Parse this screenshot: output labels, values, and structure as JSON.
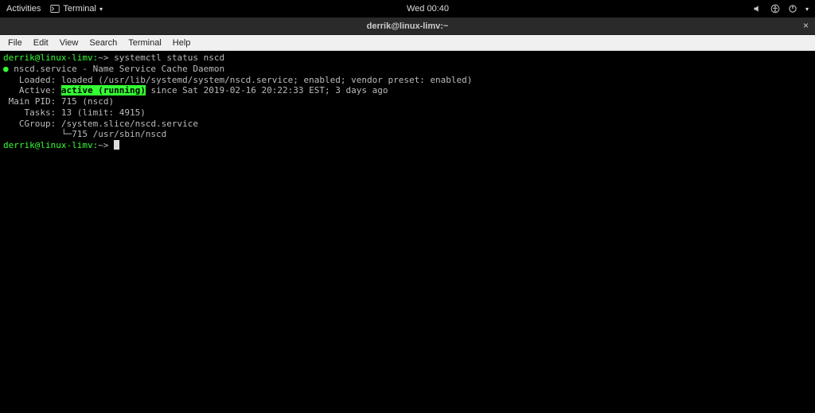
{
  "topbar": {
    "activities": "Activities",
    "app_label": "Terminal",
    "clock": "Wed 00:40"
  },
  "titlebar": {
    "title": "derrik@linux-limv:~",
    "close": "×"
  },
  "menubar": {
    "items": [
      "File",
      "Edit",
      "View",
      "Search",
      "Terminal",
      "Help"
    ]
  },
  "terminal": {
    "prompt1_user": "derrik@linux-limv:",
    "prompt1_path": "~>",
    "prompt1_cmd": " systemctl status nscd",
    "line_service": "nscd.service - Name Service Cache Daemon",
    "loaded_label": "   Loaded: ",
    "loaded_value": "loaded (/usr/lib/systemd/system/nscd.service; enabled; vendor preset: enabled)",
    "active_label": "   Active: ",
    "active_value": "active (running)",
    "active_since": " since Sat 2019-02-16 20:22:33 EST; 3 days ago",
    "mainpid_label": " Main PID: ",
    "mainpid_value": "715 (nscd)",
    "tasks_label": "    Tasks: ",
    "tasks_value": "13 (limit: 4915)",
    "cgroup_label": "   CGroup: ",
    "cgroup_value": "/system.slice/nscd.service",
    "cgroup_tree": "           └─715 /usr/sbin/nscd",
    "prompt2_user": "derrik@linux-limv:",
    "prompt2_path": "~>"
  }
}
